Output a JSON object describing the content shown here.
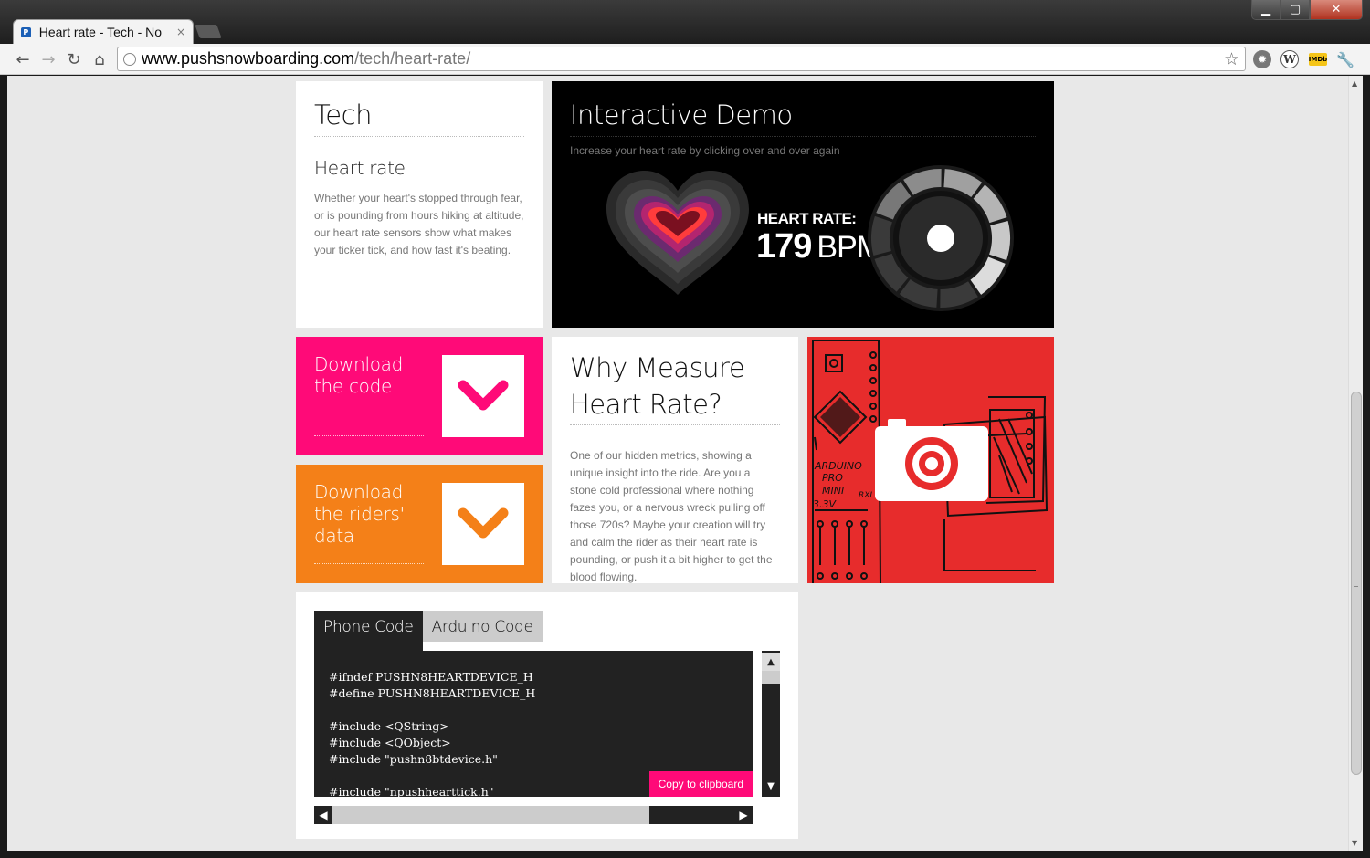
{
  "browser": {
    "tab_title": "Heart rate - Tech - No",
    "url_host": "www.pushsnowboarding.com",
    "url_path": "/tech/heart-rate/",
    "icons": [
      "back-icon",
      "forward-icon",
      "reload-icon",
      "home-icon",
      "star-icon",
      "settings-extension-icon",
      "wordpress-extension-icon",
      "imdb-extension-icon",
      "wrench-icon"
    ]
  },
  "tech": {
    "title": "Tech",
    "subtitle": "Heart rate",
    "body": "Whether your heart's stopped through fear, or is pounding from hours hiking at altitude, our heart rate sensors show what makes your ticker tick, and how fast it's beating."
  },
  "demo": {
    "title": "Interactive Demo",
    "hint": "Increase your heart rate by clicking over and over again",
    "rate_label": "HEART RATE:",
    "rate_value": "179",
    "rate_unit": "BPM",
    "gauge_level": 0.6
  },
  "downloads": {
    "code_label": "Download the code",
    "data_label": "Download the riders' data",
    "code_color": "#ff0a78",
    "data_color": "#f48018"
  },
  "why": {
    "title": "Why Measure Heart Rate?",
    "body": "One of our hidden metrics, showing a unique insight into the ride. Are you a stone cold professional where nothing fazes you, or a nervous wreck pulling off those 720s? Maybe your creation will try and calm the rider as their heart rate is pounding, or push it a bit higher to get the blood flowing."
  },
  "photo": {
    "sketch_text": [
      "ARDUINO",
      "PRO",
      "MINI",
      "3.3V",
      "RXI"
    ],
    "background": "#e72c2c"
  },
  "code": {
    "tabs": [
      "Phone Code",
      "Arduino Code"
    ],
    "lines": [
      "#ifndef PUSHN8HEARTDEVICE_H",
      "#define PUSHN8HEARTDEVICE_H",
      "",
      "#include <QString>",
      "#include <QObject>",
      "#include \"pushn8btdevice.h\"",
      "",
      "#include \"npushhearttick.h\""
    ],
    "copy_label": "Copy to clipboard"
  }
}
